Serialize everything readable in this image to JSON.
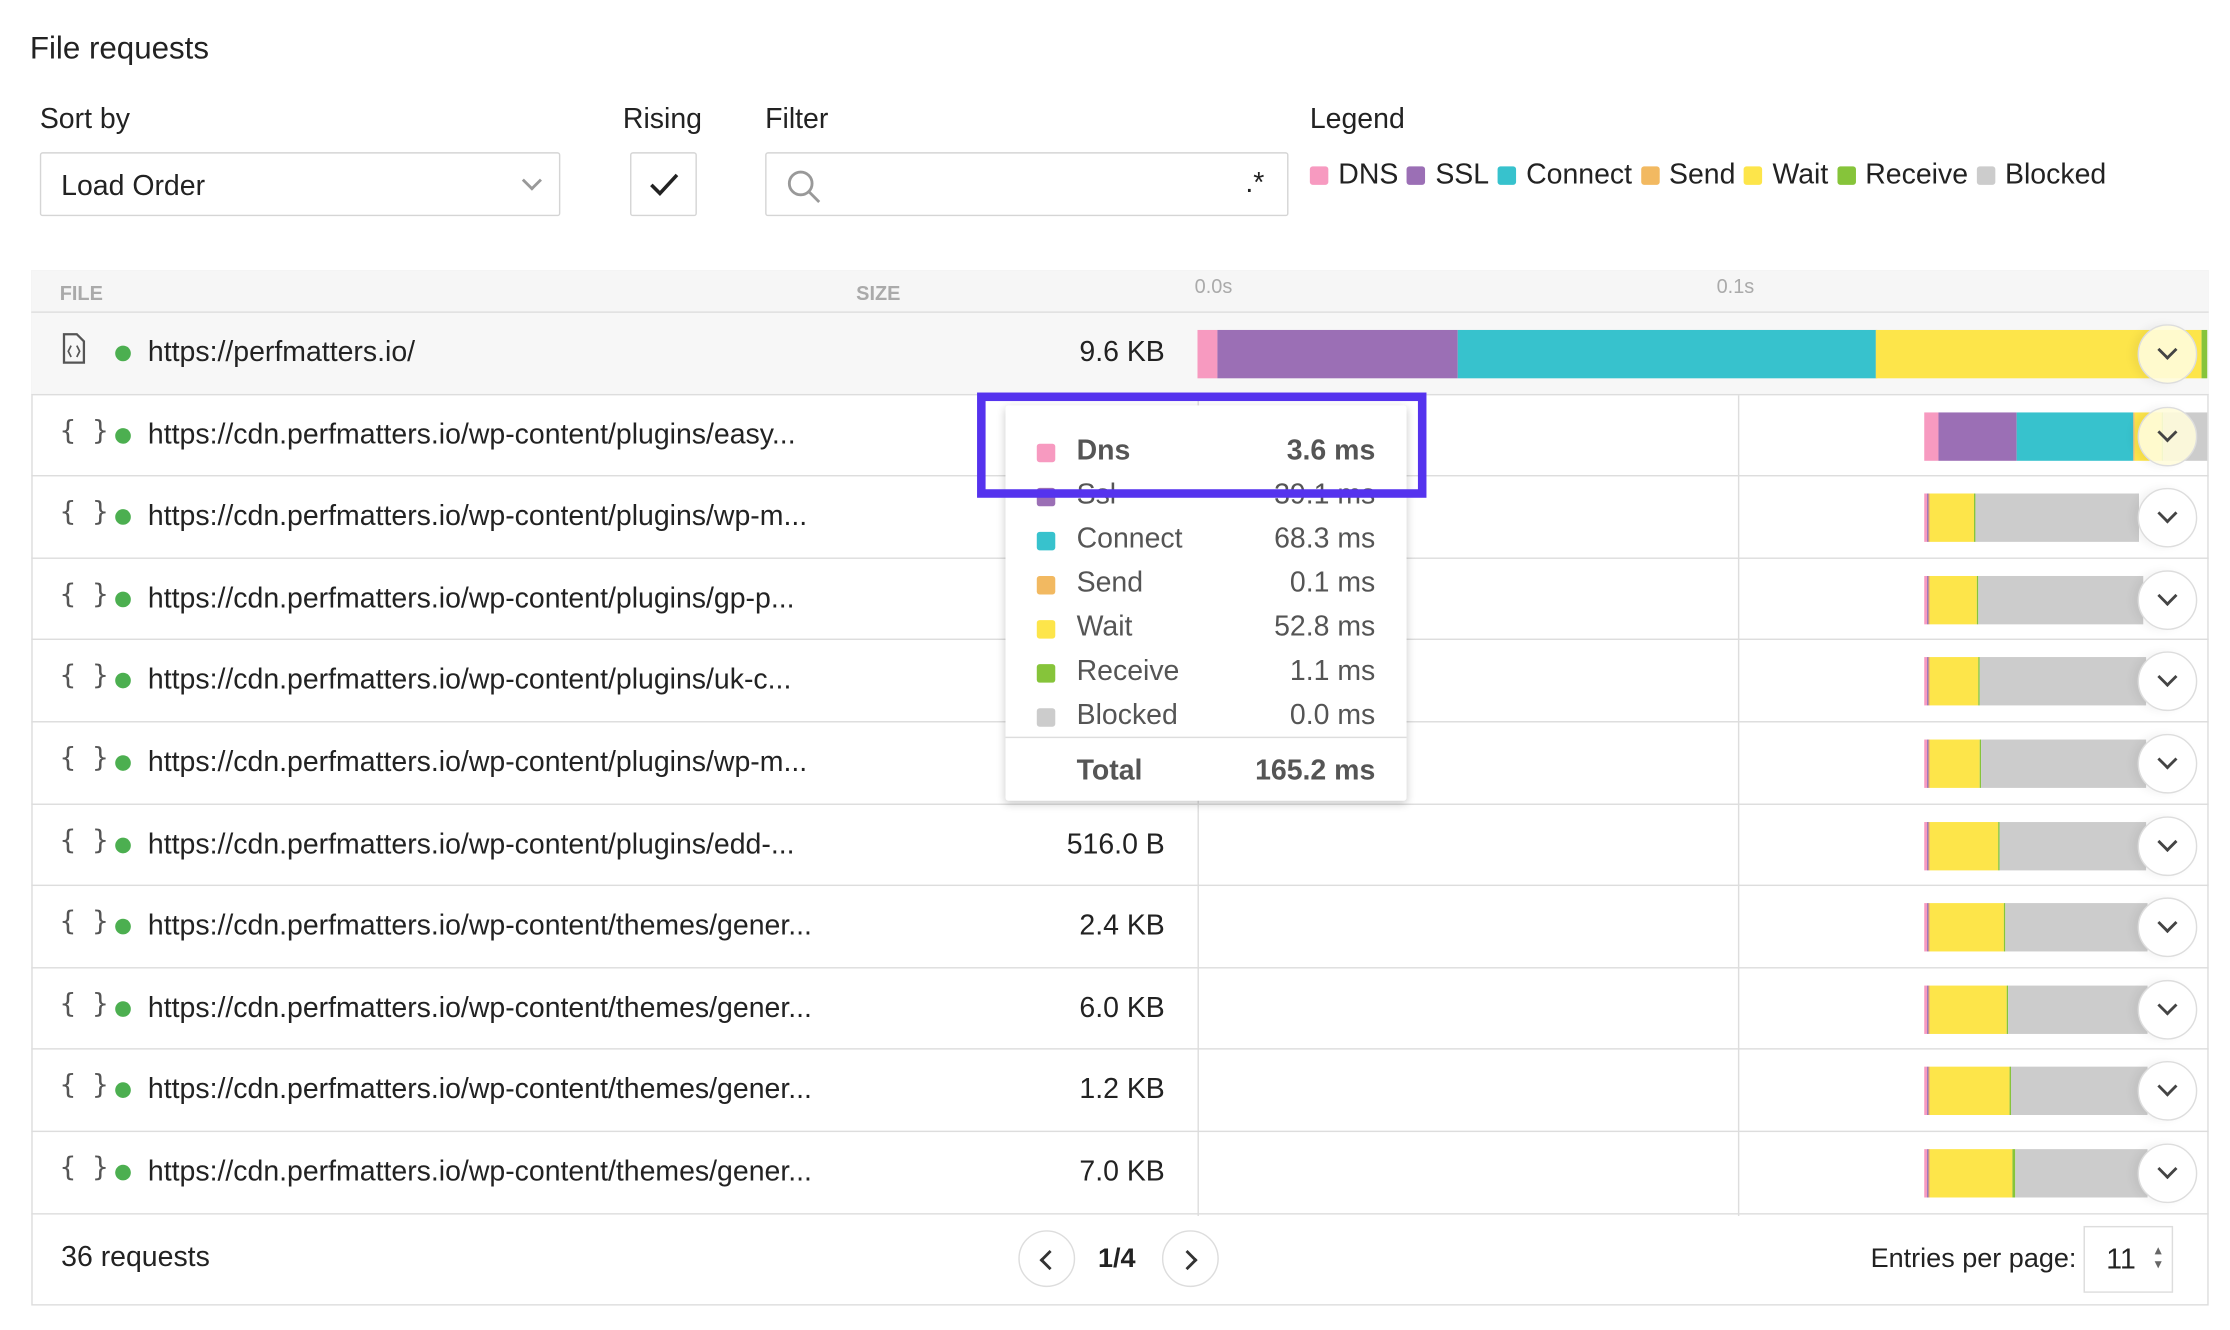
{
  "title": "File requests",
  "controls": {
    "sort_label": "Sort by",
    "sort_value": "Load Order",
    "rising_label": "Rising",
    "rising_checked": true,
    "filter_label": "Filter",
    "filter_value": "",
    "filter_regex_toggle": ".*",
    "legend_label": "Legend"
  },
  "legend": [
    {
      "name": "DNS",
      "color": "#f79ac0"
    },
    {
      "name": "SSL",
      "color": "#9b6fb5"
    },
    {
      "name": "Connect",
      "color": "#37c2cd"
    },
    {
      "name": "Send",
      "color": "#f2b961"
    },
    {
      "name": "Wait",
      "color": "#fde54a"
    },
    {
      "name": "Receive",
      "color": "#86c43a"
    },
    {
      "name": "Blocked",
      "color": "#cccccc"
    }
  ],
  "table": {
    "headers": {
      "file": "FILE",
      "size": "SIZE"
    },
    "timeline_ticks": [
      "0.0s",
      "0.1s"
    ],
    "rows": [
      {
        "icon": "document-icon",
        "url": "https://perfmatters.io/",
        "size": "9.6 KB",
        "start": 0,
        "segments": [
          3.6,
          44.5,
          77.4,
          0.1,
          60.2,
          1.1,
          0
        ]
      },
      {
        "icon": "braces-icon",
        "url": "https://cdn.perfmatters.io/wp-content/plugins/easy...",
        "size": "",
        "start": 134.5,
        "segments": [
          2.6,
          14.5,
          21.6,
          0.3,
          5,
          0.3,
          13.7
        ]
      },
      {
        "icon": "braces-icon",
        "url": "https://cdn.perfmatters.io/wp-content/plugins/wp-m...",
        "size": "",
        "start": 134.5,
        "segments": [
          0.4,
          0.4,
          0,
          0.3,
          8.1,
          0.3,
          30.3
        ]
      },
      {
        "icon": "braces-icon",
        "url": "https://cdn.perfmatters.io/wp-content/plugins/gp-p...",
        "size": "",
        "start": 134.5,
        "segments": [
          0.4,
          0.4,
          0,
          0.3,
          8.6,
          0.3,
          30.5
        ]
      },
      {
        "icon": "braces-icon",
        "url": "https://cdn.perfmatters.io/wp-content/plugins/uk-c...",
        "size": "",
        "start": 134.5,
        "segments": [
          0.4,
          0.4,
          0,
          0.3,
          8.9,
          0.3,
          30.6
        ]
      },
      {
        "icon": "braces-icon",
        "url": "https://cdn.perfmatters.io/wp-content/plugins/wp-m...",
        "size": "",
        "start": 134.5,
        "segments": [
          0.4,
          0.4,
          0,
          0.3,
          9.2,
          0.3,
          30.4
        ]
      },
      {
        "icon": "braces-icon",
        "url": "https://cdn.perfmatters.io/wp-content/plugins/edd-...",
        "size": "516.0 B",
        "start": 134.5,
        "segments": [
          0.4,
          0.4,
          0,
          0.3,
          12.6,
          0.3,
          27.0
        ]
      },
      {
        "icon": "braces-icon",
        "url": "https://cdn.perfmatters.io/wp-content/themes/gener...",
        "size": "2.4 KB",
        "start": 134.5,
        "segments": [
          0.4,
          0.4,
          0,
          0.3,
          13.7,
          0.3,
          26.1
        ]
      },
      {
        "icon": "braces-icon",
        "url": "https://cdn.perfmatters.io/wp-content/themes/gener...",
        "size": "6.0 KB",
        "start": 134.5,
        "segments": [
          0.4,
          0.4,
          0,
          0.3,
          14.2,
          0.3,
          25.6
        ]
      },
      {
        "icon": "braces-icon",
        "url": "https://cdn.perfmatters.io/wp-content/themes/gener...",
        "size": "1.2 KB",
        "start": 134.5,
        "segments": [
          0.4,
          0.4,
          0,
          0.3,
          14.7,
          0.3,
          25.1
        ]
      },
      {
        "icon": "braces-icon",
        "url": "https://cdn.perfmatters.io/wp-content/themes/gener...",
        "size": "7.0 KB",
        "start": 134.5,
        "segments": [
          0.4,
          0.4,
          0,
          0.3,
          15.3,
          0.3,
          24.5
        ]
      }
    ]
  },
  "tooltip": {
    "rows": [
      {
        "name": "Dns",
        "value": "3.6 ms",
        "color": "#f79ac0",
        "bold": true
      },
      {
        "name": "Ssl",
        "value": "39.1 ms",
        "color": "#9b6fb5"
      },
      {
        "name": "Connect",
        "value": "68.3 ms",
        "color": "#37c2cd"
      },
      {
        "name": "Send",
        "value": "0.1 ms",
        "color": "#f2b961"
      },
      {
        "name": "Wait",
        "value": "52.8 ms",
        "color": "#fde54a"
      },
      {
        "name": "Receive",
        "value": "1.1 ms",
        "color": "#86c43a"
      },
      {
        "name": "Blocked",
        "value": "0.0 ms",
        "color": "#cccccc"
      }
    ],
    "total_label": "Total",
    "total_value": "165.2 ms"
  },
  "highlight_color": "#5533ee",
  "footer": {
    "count": "36 requests",
    "page": "1/4",
    "entries_label": "Entries per page:",
    "entries_value": "11"
  }
}
